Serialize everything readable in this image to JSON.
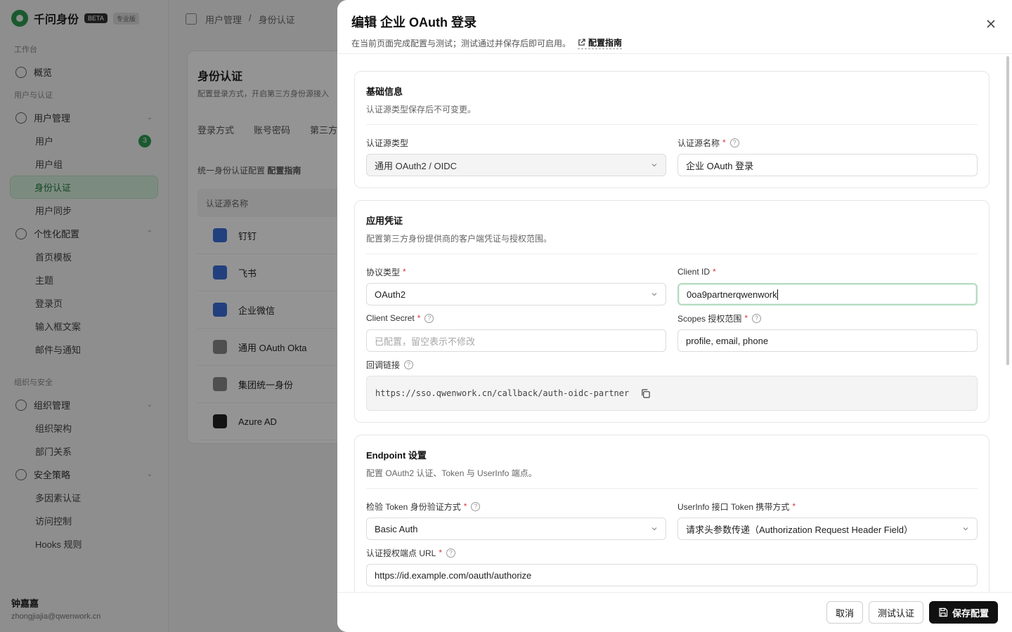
{
  "background": {
    "app_name": "千问身份",
    "badge": "BETA",
    "badge2": "专业版",
    "nav_group_1": "工作台",
    "nav_overview": "概览",
    "nav_group_2": "用户与认证",
    "nav_user_mgmt": "用户管理",
    "nav_users": "用户",
    "nav_users_count": "3",
    "nav_user_groups": "用户组",
    "nav_identity_auth": "身份认证",
    "nav_user_sync": "用户同步",
    "nav_personalize": "个性化配置",
    "nav_home_page": "首页模板",
    "nav_theme": "主题",
    "nav_login_page": "登录页",
    "nav_custom_text": "输入框文案",
    "nav_custom_domain": "邮件与通知",
    "nav_group_3": "组织与安全",
    "nav_org_mgmt": "组织管理",
    "nav_org_struct": "组织架构",
    "nav_dept_rel": "部门关系",
    "nav_security": "安全策略",
    "nav_mfa": "多因素认证",
    "nav_access": "访问控制",
    "nav_hooks": "Hooks 规则",
    "user_name": "钟嘉嘉",
    "user_mail": "zhongjiajia@qwenwork.cn",
    "breadcrumb_1": "用户管理",
    "breadcrumb_sep": "/",
    "breadcrumb_2": "身份认证",
    "panel_title": "身份认证",
    "panel_sub": "配置登录方式，开启第三方身份源接入",
    "tab_1": "登录方式",
    "tab_2": "账号密码",
    "tab_3": "第三方",
    "note": "统一身份认证配置",
    "note_link": "配置指南",
    "table_header": "认证源名称",
    "rows": [
      "钉钉",
      "飞书",
      "企业微信",
      "通用 OAuth Okta",
      "集团统一身份",
      "Azure AD"
    ]
  },
  "drawer": {
    "title": "编辑 企业 OAuth 登录",
    "subtitle": "在当前页面完成配置与测试；测试通过并保存后即可启用。",
    "guide_link": "配置指南",
    "section_basic": {
      "title": "基础信息",
      "desc": "认证源类型保存后不可变更。",
      "type_label": "认证源类型",
      "type_value": "通用 OAuth2 / OIDC",
      "name_label": "认证源名称",
      "name_value": "企业 OAuth 登录"
    },
    "section_cred": {
      "title": "应用凭证",
      "desc": "配置第三方身份提供商的客户端凭证与授权范围。",
      "protocol_label": "协议类型",
      "protocol_value": "OAuth2",
      "client_id_label": "Client ID",
      "client_id_value": "0oa9partnerqwenwork",
      "secret_label": "Client Secret",
      "secret_placeholder": "已配置，留空表示不修改",
      "scopes_label": "Scopes 授权范围",
      "scopes_value": "profile, email, phone",
      "callback_label": "回调链接",
      "callback_value": "https://sso.qwenwork.cn/callback/auth-oidc-partner"
    },
    "section_endpoint": {
      "title": "Endpoint 设置",
      "desc": "配置 OAuth2 认证、Token 与 UserInfo 端点。",
      "token_auth_label": "检验 Token 身份验证方式",
      "token_auth_value": "Basic Auth",
      "userinfo_label": "UserInfo 接口 Token 携带方式",
      "userinfo_value": "请求头参数传递（Authorization Request Header Field）",
      "authorize_label": "认证授权端点 URL",
      "authorize_value": "https://id.example.com/oauth/authorize"
    },
    "buttons": {
      "cancel": "取消",
      "test": "测试认证",
      "save": "保存配置"
    }
  }
}
